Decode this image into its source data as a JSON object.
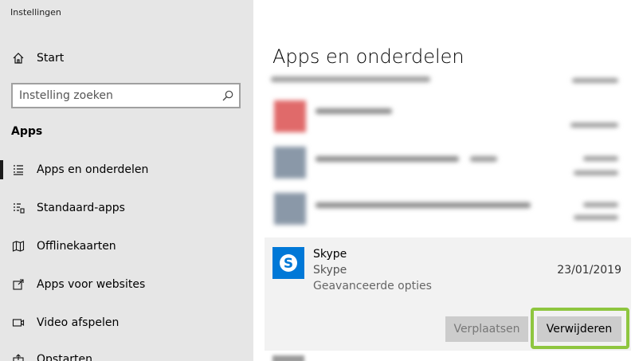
{
  "window": {
    "title": "Instellingen"
  },
  "sidebar": {
    "home_label": "Start",
    "search": {
      "placeholder": "Instelling zoeken"
    },
    "section_title": "Apps",
    "items": [
      {
        "label": "Apps en onderdelen",
        "icon": "list-icon"
      },
      {
        "label": "Standaard-apps",
        "icon": "default-apps-icon"
      },
      {
        "label": "Offlinekaarten",
        "icon": "map-icon"
      },
      {
        "label": "Apps voor websites",
        "icon": "open-link-icon"
      },
      {
        "label": "Video afspelen",
        "icon": "video-icon"
      },
      {
        "label": "Opstarten",
        "icon": "startup-icon"
      }
    ]
  },
  "main": {
    "title": "Apps en onderdelen",
    "selected_app": {
      "name": "Skype",
      "publisher": "Skype",
      "advanced": "Geavanceerde opties",
      "date": "23/01/2019",
      "move_label": "Verplaatsen",
      "uninstall_label": "Verwijderen"
    }
  },
  "colors": {
    "accent": "#0078d7",
    "highlight": "#8ec63f",
    "sidebar": "#e6e6e6"
  }
}
